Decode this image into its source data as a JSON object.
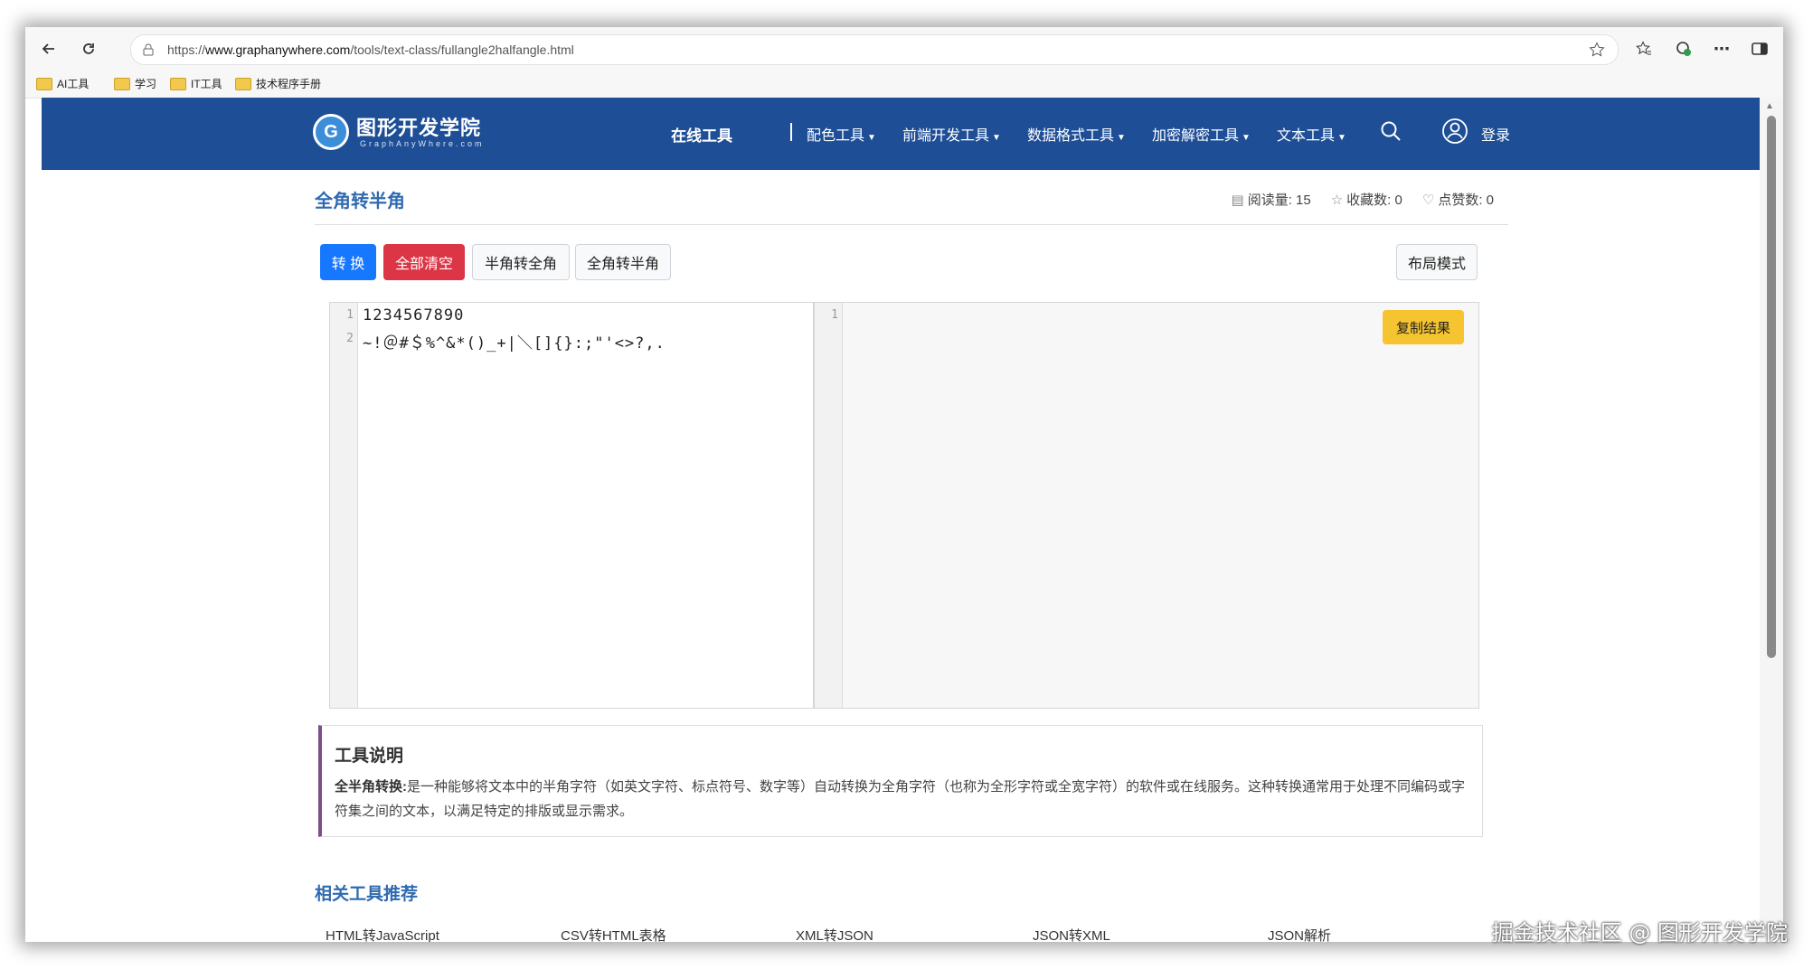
{
  "browser": {
    "url_prefix": "https://",
    "url_host": "www.graphanywhere.com",
    "url_path": "/tools/text-class/fullangle2halfangle.html",
    "bookmarks": [
      "AI工具",
      "学习",
      "IT工具",
      "技术程序手册"
    ]
  },
  "header": {
    "logo_text": "图形开发学院",
    "logo_sub": "GraphAnyWhere.com",
    "menu": {
      "online": "在线工具",
      "color": "配色工具",
      "frontend": "前端开发工具",
      "dataformat": "数据格式工具",
      "crypto": "加密解密工具",
      "text": "文本工具"
    },
    "login": "登录"
  },
  "page": {
    "title": "全角转半角",
    "reads_label": "阅读量:",
    "reads": "15",
    "favs_label": "收藏数:",
    "favs": "0",
    "likes_label": "点赞数:",
    "likes": "0"
  },
  "toolbar": {
    "convert": "转 换",
    "clear": "全部清空",
    "half2full": "半角转全角",
    "full2half": "全角转半角",
    "layout": "布局模式"
  },
  "editor": {
    "left_lines": [
      "1234567890",
      "~!＠#＄%^&*()_+|＼[]{}:;\"'<>?,."
    ],
    "left_line_numbers": [
      "1",
      "2"
    ],
    "right_line_numbers": [
      "1"
    ],
    "copy": "复制结果"
  },
  "description": {
    "title": "工具说明",
    "term": "全半角转换:",
    "body": "是一种能够将文本中的半角字符（如英文字符、标点符号、数字等）自动转换为全角字符（也称为全形字符或全宽字符）的软件或在线服务。这种转换通常用于处理不同编码或字符集之间的文本，以满足特定的排版或显示需求。"
  },
  "related": {
    "title": "相关工具推荐",
    "items": [
      "HTML转JavaScript",
      "CSV转HTML表格",
      "XML转JSON",
      "JSON转XML",
      "JSON解析"
    ]
  },
  "watermark": "掘金技术社区 @ 图形开发学院",
  "colors": {
    "header_bg": "#1e4e96",
    "primary": "#1677ff",
    "danger": "#dc3545",
    "warning": "#f5c430",
    "title_blue": "#2f6ab0"
  }
}
